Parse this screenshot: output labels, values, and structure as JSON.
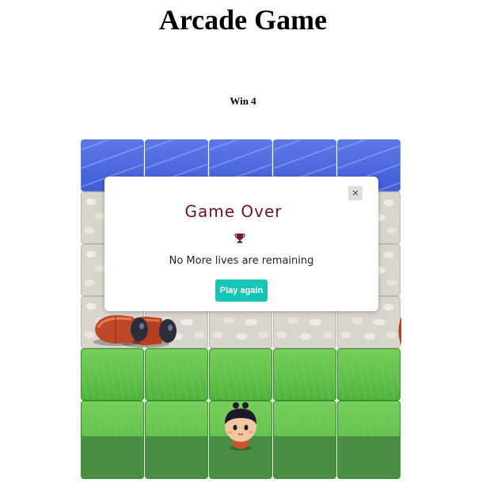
{
  "page": {
    "title": "Arcade Game",
    "status": "Win 4"
  },
  "board": {
    "columns": 5,
    "rows": [
      "water",
      "stone",
      "stone",
      "stone",
      "grass",
      "grass"
    ]
  },
  "sprites": {
    "enemy": "red-beetle",
    "player": "boy-character"
  },
  "modal": {
    "close_label": "×",
    "title": "Game Over",
    "icon": "trophy-icon",
    "message": "No More lives are remaining",
    "button_label": "Play again"
  },
  "colors": {
    "modal_title": "#6b1038",
    "play_button": "#16c5b7",
    "water": "#4a68de",
    "grass": "#5fbf48"
  }
}
